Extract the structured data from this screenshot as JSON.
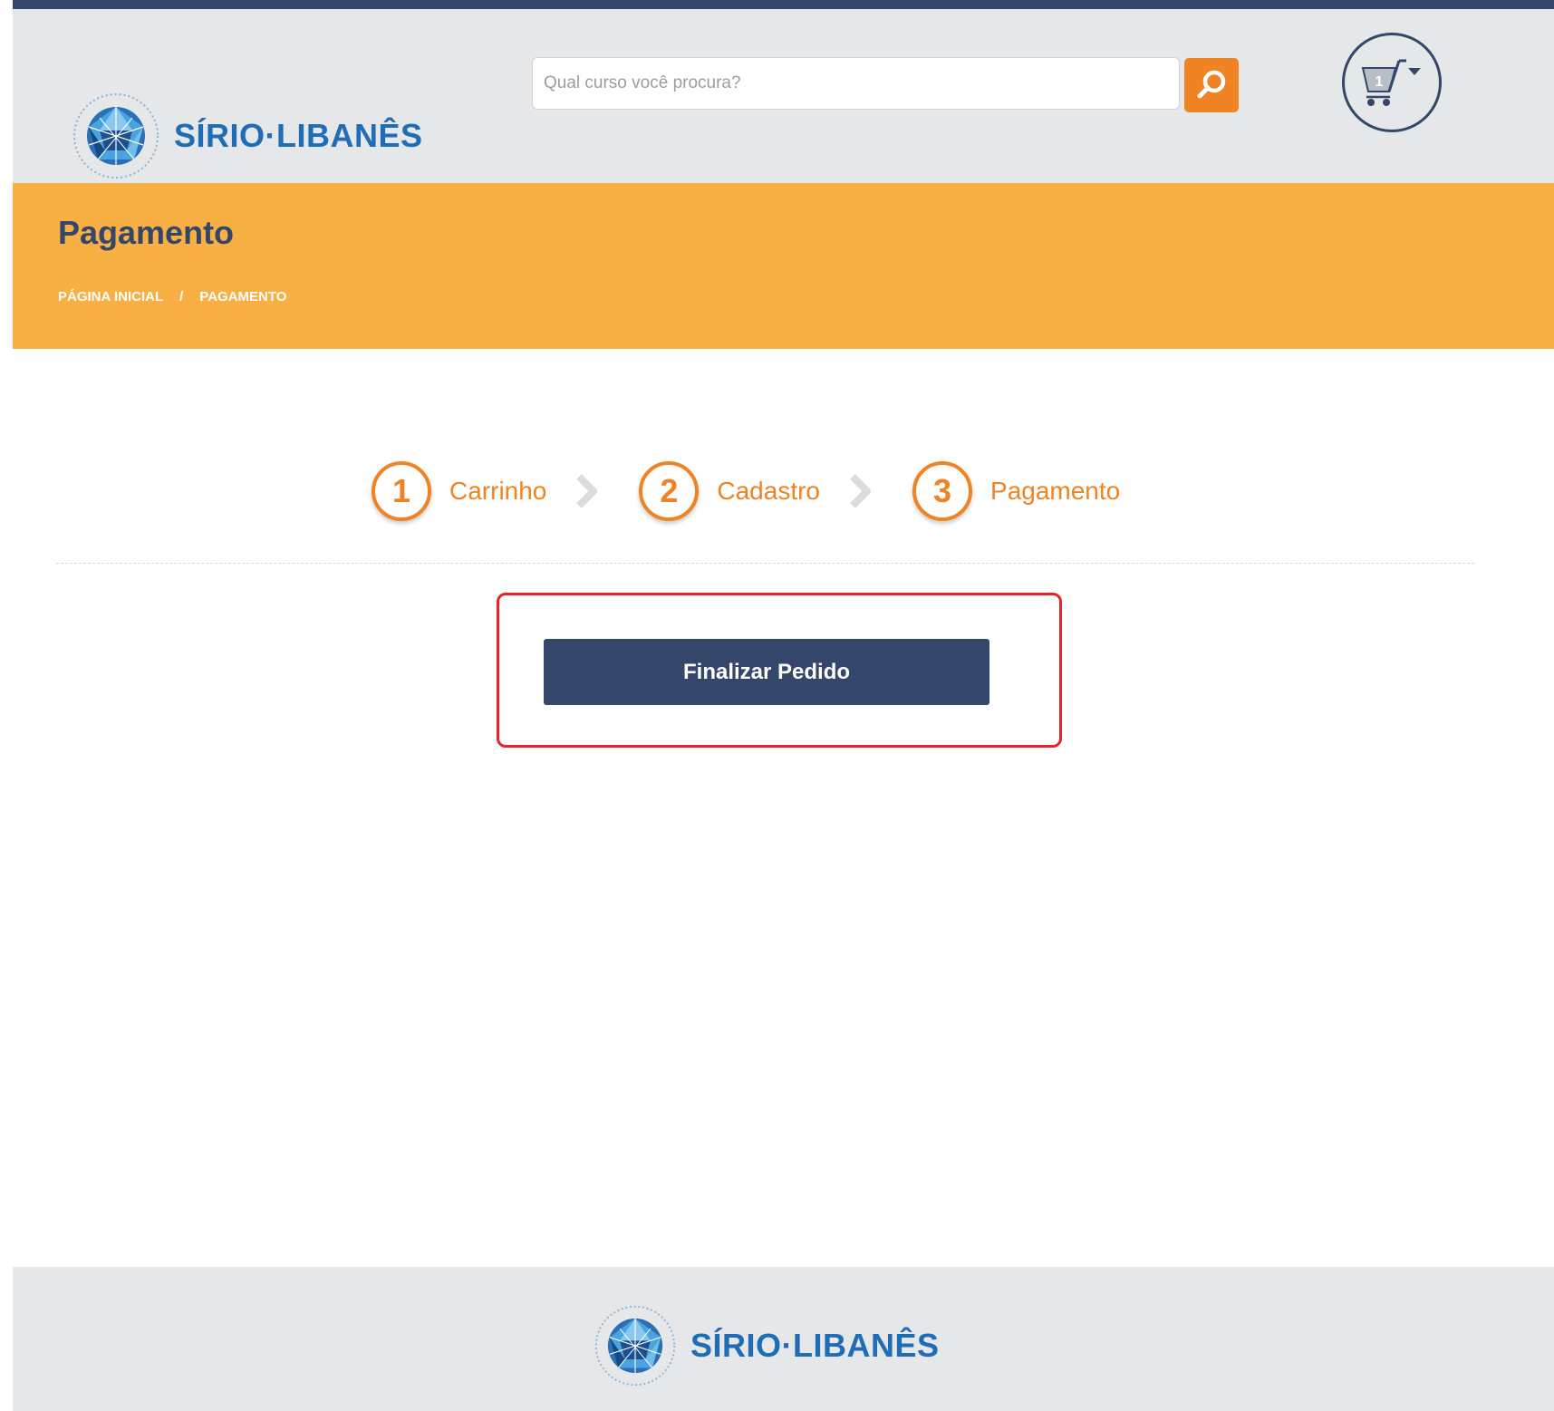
{
  "brand": {
    "name": "SÍRIO·LIBANÊS",
    "primary_color": "#34466a",
    "accent_color": "#f08324",
    "band_color": "#f8af44",
    "logo_blue": "#1e6db6"
  },
  "header": {
    "search": {
      "placeholder": "Qual curso você procura?",
      "value": "",
      "button_icon": "search-icon"
    },
    "cart": {
      "icon": "cart-icon",
      "count": "1"
    }
  },
  "banner": {
    "title": "Pagamento",
    "breadcrumb": {
      "home": "PÁGINA INICIAL",
      "separator": "/",
      "current": "PAGAMENTO"
    }
  },
  "steps": [
    {
      "number": "1",
      "label": "Carrinho"
    },
    {
      "number": "2",
      "label": "Cadastro"
    },
    {
      "number": "3",
      "label": "Pagamento"
    }
  ],
  "checkout": {
    "finalize_label": "Finalizar Pedido",
    "highlight_color": "#e3242b"
  },
  "footer": {
    "brand_name": "SÍRIO·LIBANÊS"
  }
}
